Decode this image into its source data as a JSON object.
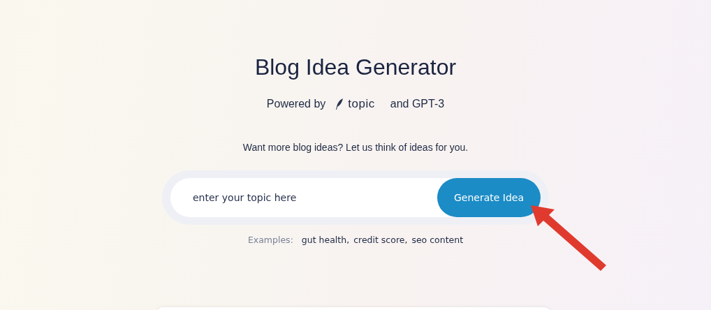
{
  "title": "Blog Idea Generator",
  "powered": {
    "prefix": "Powered by",
    "brand": "topic",
    "suffix": "and GPT-3"
  },
  "subtitle": "Want more blog ideas? Let us think of ideas for you.",
  "search": {
    "placeholder": "enter your topic here",
    "button": "Generate Idea"
  },
  "examples": {
    "label": "Examples:",
    "items": [
      "gut health,",
      "credit score,",
      "seo content"
    ]
  }
}
